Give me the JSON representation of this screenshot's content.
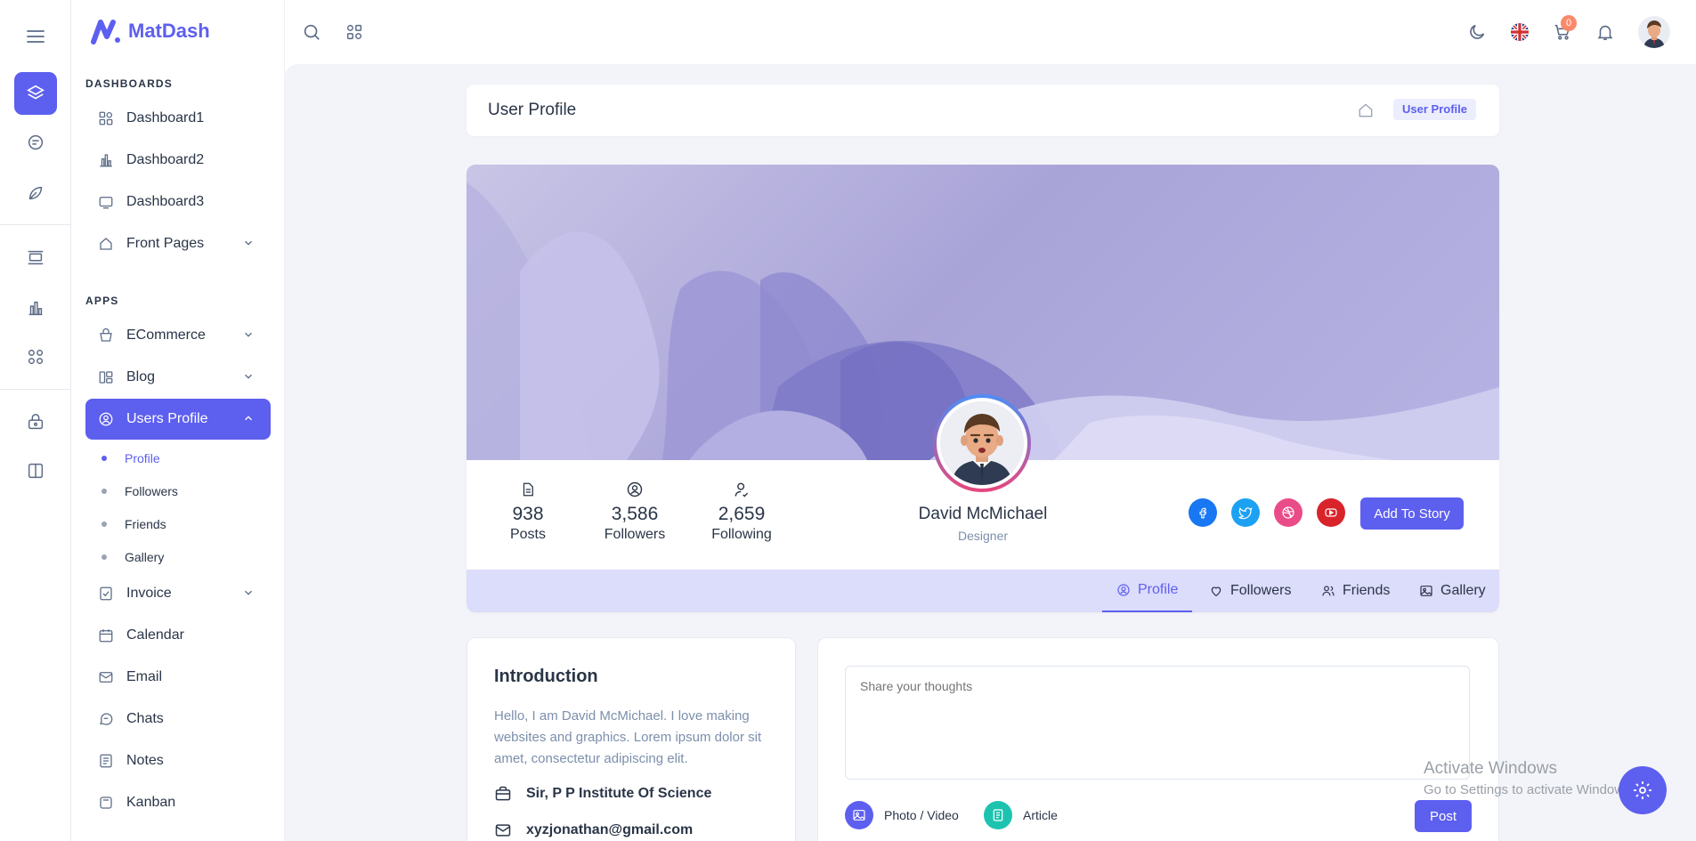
{
  "app": {
    "name": "MatDash"
  },
  "rail": {
    "icons": [
      "layers-icon",
      "chat-icon",
      "leaf-icon",
      "layout-icon",
      "chart-icon",
      "apps-icon",
      "lock-icon",
      "split-icon"
    ]
  },
  "sidebar": {
    "section_dashboards": "DASHBOARDS",
    "section_apps": "APPS",
    "items": [
      {
        "label": "Dashboard1"
      },
      {
        "label": "Dashboard2"
      },
      {
        "label": "Dashboard3"
      },
      {
        "label": "Front Pages"
      },
      {
        "label": "ECommerce"
      },
      {
        "label": "Blog"
      },
      {
        "label": "Users Profile"
      },
      {
        "label": "Invoice"
      },
      {
        "label": "Calendar"
      },
      {
        "label": "Email"
      },
      {
        "label": "Chats"
      },
      {
        "label": "Notes"
      },
      {
        "label": "Kanban"
      }
    ],
    "sub_items": [
      {
        "label": "Profile"
      },
      {
        "label": "Followers"
      },
      {
        "label": "Friends"
      },
      {
        "label": "Gallery"
      }
    ]
  },
  "topbar": {
    "cart_count": "0"
  },
  "breadcrumb": {
    "title": "User Profile",
    "current": "User Profile"
  },
  "profile": {
    "name": "David McMichael",
    "role": "Designer",
    "stats": [
      {
        "value": "938",
        "label": "Posts"
      },
      {
        "value": "3,586",
        "label": "Followers"
      },
      {
        "value": "2,659",
        "label": "Following"
      }
    ],
    "add_story": "Add To Story",
    "social_colors": {
      "facebook": "#1877f2",
      "twitter": "#1da1f2",
      "dribbble": "#ea4c89",
      "youtube": "#d9232a"
    },
    "tabs": [
      {
        "label": "Profile"
      },
      {
        "label": "Followers"
      },
      {
        "label": "Friends"
      },
      {
        "label": "Gallery"
      }
    ]
  },
  "intro": {
    "title": "Introduction",
    "text": "Hello, I am David McMichael. I love making websites and graphics. Lorem ipsum dolor sit amet, consectetur adipiscing elit.",
    "institute": "Sir, P P Institute Of Science",
    "email": "xyzjonathan@gmail.com"
  },
  "post": {
    "placeholder": "Share your thoughts",
    "photo_video": "Photo / Video",
    "article": "Article",
    "post_button": "Post"
  },
  "watermark": {
    "line1": "Activate Windows",
    "line2": "Go to Settings to activate Windows."
  },
  "colors": {
    "primary": "#5d5fef",
    "secondary": "#1ec3b0"
  }
}
